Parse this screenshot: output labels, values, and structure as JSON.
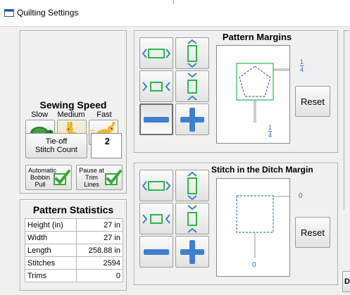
{
  "window": {
    "title": "Quilting Settings"
  },
  "sewing_speed": {
    "title": "Sewing Speed",
    "slow_label": "Slow",
    "medium_label": "Medium",
    "fast_label": "Fast",
    "selected": "Medium"
  },
  "tieoff": {
    "label_line1": "Tie-off",
    "label_line2": "Stitch Count",
    "value": "2"
  },
  "options": {
    "auto_bobbin": {
      "line1": "Automatic",
      "line2": "Bobbin",
      "line3": "Pull",
      "checked": true
    },
    "pause_trim": {
      "line1": "Pause at",
      "line2": "Trim",
      "line3": "Lines",
      "checked": true
    }
  },
  "statistics": {
    "title": "Pattern Statistics",
    "rows": [
      {
        "label": "Height (in)",
        "value": "27 in"
      },
      {
        "label": "Width",
        "value": "27 in"
      },
      {
        "label": "Length",
        "value": "258.88 in"
      },
      {
        "label": "Stitches",
        "value": "2594"
      },
      {
        "label": "Trims",
        "value": "0"
      }
    ]
  },
  "pattern_margins": {
    "title": "Pattern Margins",
    "right_value": {
      "num": "1",
      "den": "4"
    },
    "bottom_value": {
      "num": "1",
      "den": "4"
    },
    "reset_label": "Reset"
  },
  "ditch_margin": {
    "title": "Stitch in the Ditch Margin",
    "right_value": "0",
    "bottom_value": "0",
    "reset_label": "Reset"
  },
  "colors": {
    "accent_blue": "#3f7fd0",
    "accent_green": "#2db84a",
    "dashed_purple": "#6b4fcf",
    "dashed_teal": "#2c8da3",
    "check_green": "#3aa83a"
  }
}
